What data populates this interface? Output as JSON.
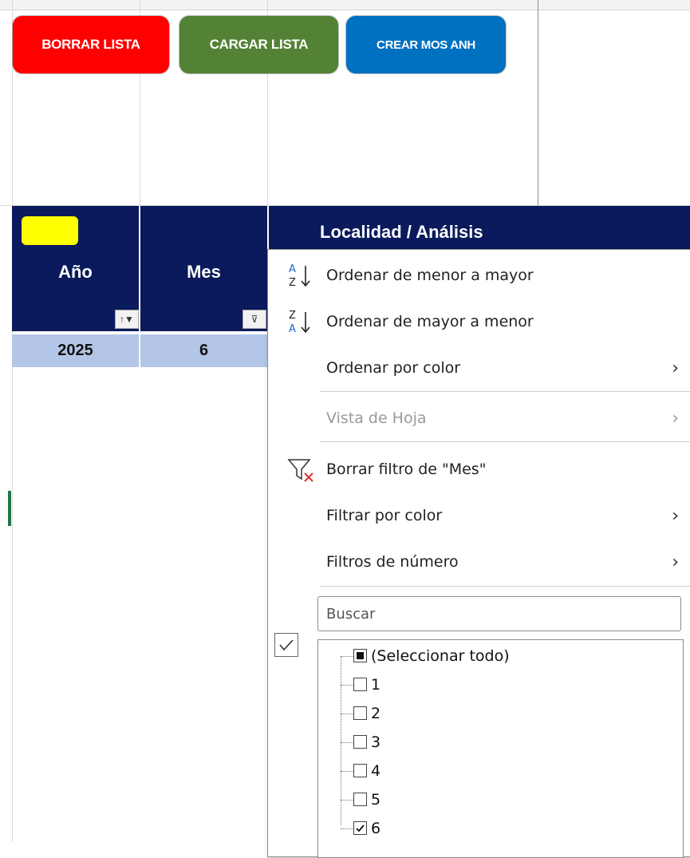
{
  "buttons": {
    "borrar": "BORRAR LISTA",
    "cargar": "CARGAR LISTA",
    "crear": "CREAR MOS ANH"
  },
  "table": {
    "headers": [
      "Año",
      "Mes",
      "Localidad / Análisis"
    ],
    "row": [
      "2025",
      "6"
    ]
  },
  "colors": {
    "header_bg": "#0a1a5c",
    "row_bg": "#b4c6e7",
    "red": "#ff0000",
    "green": "#548235",
    "blue": "#0070c0",
    "highlight": "#ffff00"
  },
  "menu": {
    "sort_asc": "Ordenar de menor a mayor",
    "sort_desc": "Ordenar de mayor a menor",
    "sort_color": "Ordenar por color",
    "sheet_view": "Vista de Hoja",
    "clear_filter": "Borrar filtro de \"Mes\"",
    "filter_color": "Filtrar por color",
    "number_filters": "Filtros de número",
    "search_placeholder": "Buscar",
    "list": [
      {
        "label": "(Seleccionar todo)",
        "state": "partial"
      },
      {
        "label": "1",
        "state": "unchecked"
      },
      {
        "label": "2",
        "state": "unchecked"
      },
      {
        "label": "3",
        "state": "unchecked"
      },
      {
        "label": "4",
        "state": "unchecked"
      },
      {
        "label": "5",
        "state": "unchecked"
      },
      {
        "label": "6",
        "state": "checked"
      }
    ]
  }
}
